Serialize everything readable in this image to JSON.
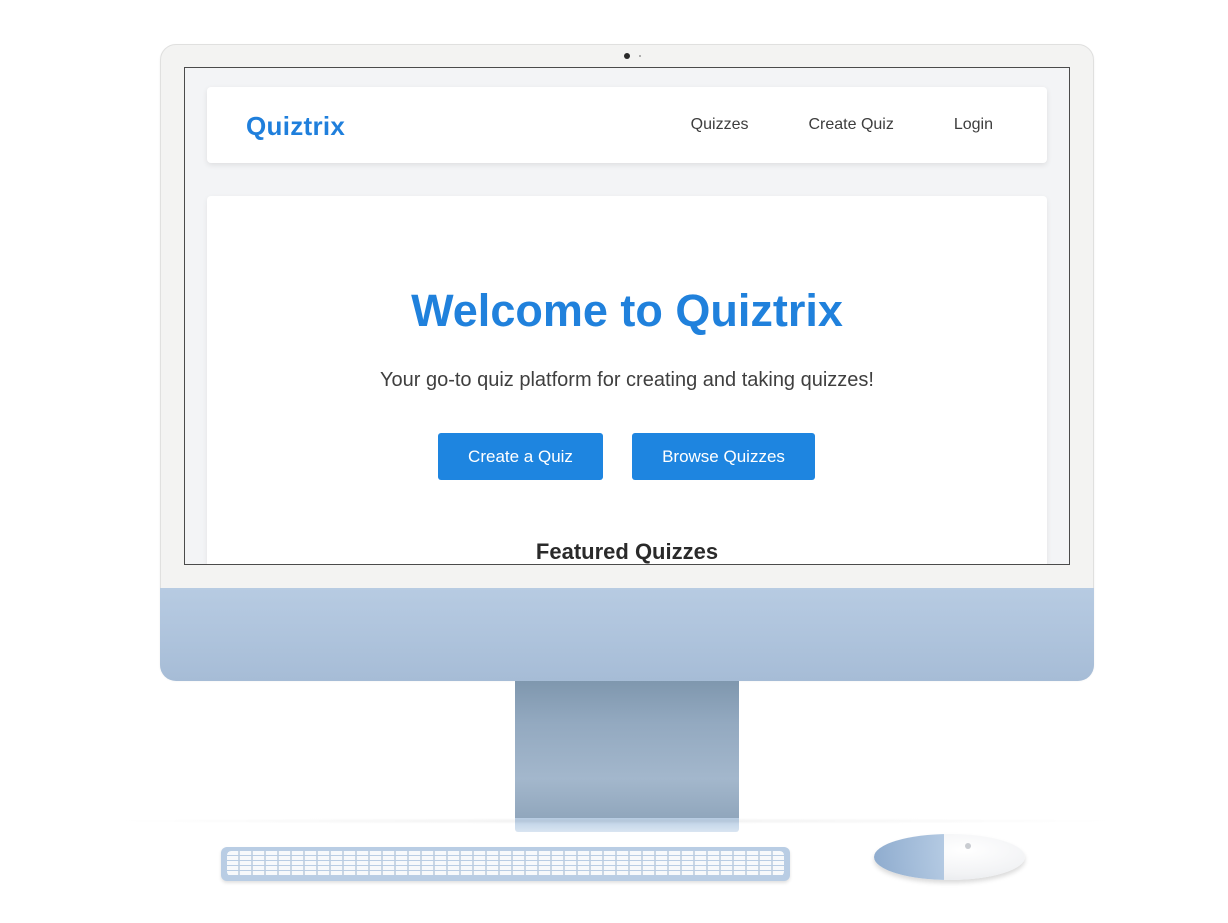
{
  "app": {
    "brand": "Quiztrix"
  },
  "nav": {
    "items": [
      {
        "label": "Quizzes"
      },
      {
        "label": "Create Quiz"
      },
      {
        "label": "Login"
      }
    ]
  },
  "hero": {
    "title": "Welcome to Quiztrix",
    "subtitle": "Your go-to quiz platform for creating and taking quizzes!",
    "primary_button": "Create a Quiz",
    "secondary_button": "Browse Quizzes"
  },
  "featured": {
    "title": "Featured Quizzes"
  },
  "colors": {
    "accent": "#1f7fdc",
    "button": "#1e85e0",
    "imac_blue": "#aec3dc"
  }
}
